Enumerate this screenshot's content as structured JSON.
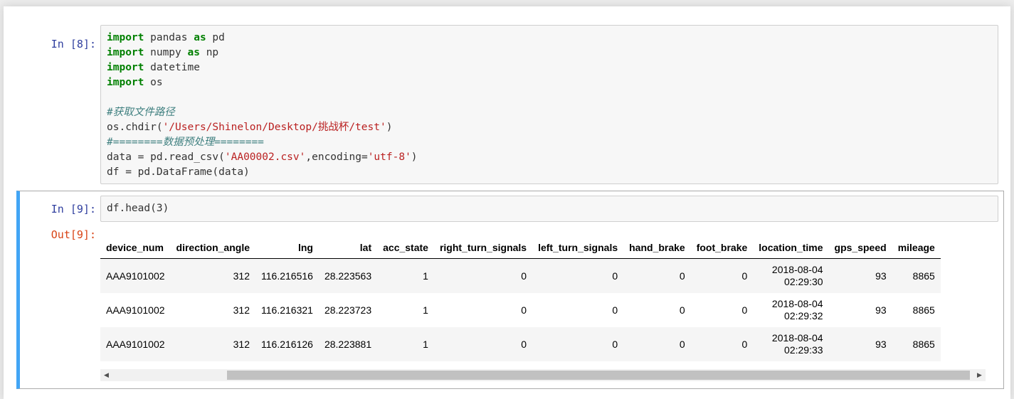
{
  "cells": [
    {
      "prompt": "In  [8]:",
      "code_lines": [
        [
          {
            "t": "import",
            "c": "kw"
          },
          {
            "t": " pandas "
          },
          {
            "t": "as",
            "c": "kw"
          },
          {
            "t": " pd"
          }
        ],
        [
          {
            "t": "import",
            "c": "kw"
          },
          {
            "t": " numpy "
          },
          {
            "t": "as",
            "c": "kw"
          },
          {
            "t": " np"
          }
        ],
        [
          {
            "t": "import",
            "c": "kw"
          },
          {
            "t": " datetime"
          }
        ],
        [
          {
            "t": "import",
            "c": "kw"
          },
          {
            "t": " os"
          }
        ],
        [],
        [
          {
            "t": "#获取文件路径",
            "c": "cmt"
          }
        ],
        [
          {
            "t": "os.chdir("
          },
          {
            "t": "'/Users/Shinelon/Desktop/挑战杯/test'",
            "c": "str"
          },
          {
            "t": ")"
          }
        ],
        [
          {
            "t": "#========数据预处理========",
            "c": "cmt"
          }
        ],
        [
          {
            "t": "data = pd.read_csv("
          },
          {
            "t": "'AA00002.csv'",
            "c": "str"
          },
          {
            "t": ",encoding="
          },
          {
            "t": "'utf-8'",
            "c": "str"
          },
          {
            "t": ")"
          }
        ],
        [
          {
            "t": "df = pd.DataFrame(data)"
          }
        ]
      ]
    },
    {
      "prompt": "In  [9]:",
      "code_lines": [
        [
          {
            "t": "df.head(3)"
          }
        ]
      ],
      "out_prompt": "Out[9]:"
    }
  ],
  "table": {
    "columns": [
      "device_num",
      "direction_angle",
      "lng",
      "lat",
      "acc_state",
      "right_turn_signals",
      "left_turn_signals",
      "hand_brake",
      "foot_brake",
      "location_time",
      "gps_speed",
      "mileage"
    ],
    "rows": [
      [
        "AAA9101002",
        "312",
        "116.216516",
        "28.223563",
        "1",
        "0",
        "0",
        "0",
        "0",
        "2018-08-04\n02:29:30",
        "93",
        "8865"
      ],
      [
        "AAA9101002",
        "312",
        "116.216321",
        "28.223723",
        "1",
        "0",
        "0",
        "0",
        "0",
        "2018-08-04\n02:29:32",
        "93",
        "8865"
      ],
      [
        "AAA9101002",
        "312",
        "116.216126",
        "28.223881",
        "1",
        "0",
        "0",
        "0",
        "0",
        "2018-08-04\n02:29:33",
        "93",
        "8865"
      ]
    ]
  },
  "scrollbar": {
    "left_arrow": "◀",
    "right_arrow": "▶"
  }
}
